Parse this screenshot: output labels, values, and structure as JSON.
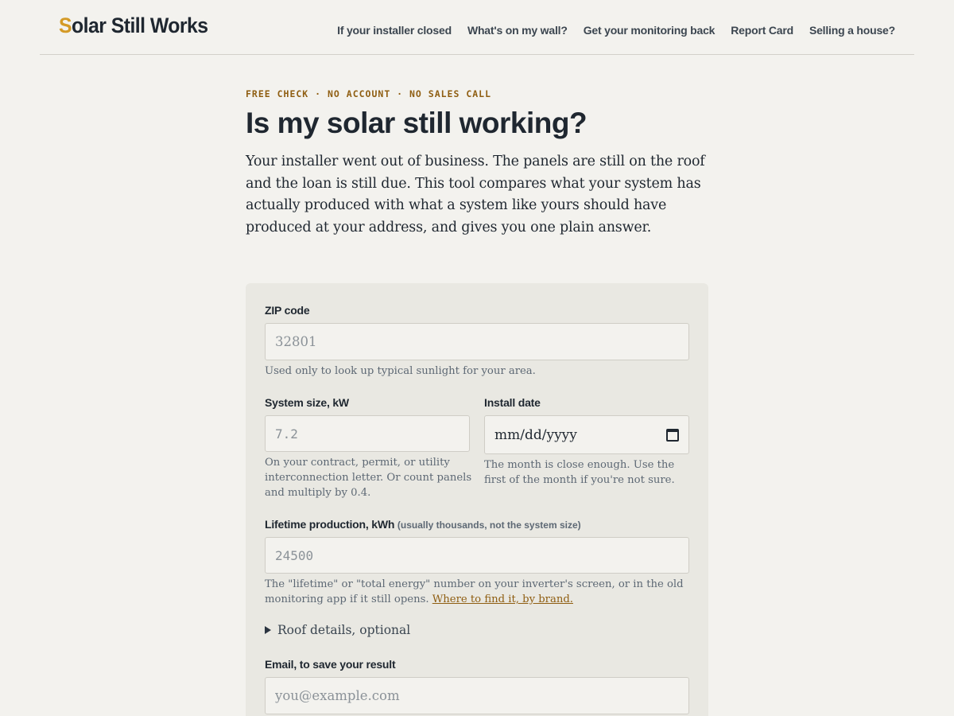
{
  "header": {
    "logo_first": "S",
    "logo_rest": "olar Still Works",
    "nav": [
      "If your installer closed",
      "What's on my wall?",
      "Get your monitoring back",
      "Report Card",
      "Selling a house?"
    ]
  },
  "hero": {
    "eyebrow": "FREE CHECK · NO ACCOUNT · NO SALES CALL",
    "title": "Is my solar still working?",
    "lede": "Your installer went out of business. The panels are still on the roof and the loan is still due. This tool compares what your system has actually produced with what a system like yours should have produced at your address, and gives you one plain answer."
  },
  "form": {
    "zip": {
      "label": "ZIP code",
      "placeholder": "32801",
      "help": "Used only to look up typical sunlight for your area."
    },
    "size": {
      "label": "System size, kW",
      "placeholder": "7.2",
      "help": "On your contract, permit, or utility interconnection letter. Or count panels and multiply by 0.4."
    },
    "install_date": {
      "label": "Install date",
      "value": "mm/dd/yyyy",
      "help": "The month is close enough. Use the first of the month if you're not sure."
    },
    "production": {
      "label": "Lifetime production, kWh",
      "sublabel": "(usually thousands, not the system size)",
      "placeholder": "24500",
      "help": "The \"lifetime\" or \"total energy\" number on your inverter's screen, or in the old monitoring app if it still opens.",
      "help_link": "Where to find it, by brand."
    },
    "roof_details": "Roof details, optional",
    "email": {
      "label": "Email, to save your result",
      "placeholder": "you@example.com"
    }
  },
  "colors": {
    "background": "#f3f2ee",
    "card": "#e9e8e2",
    "accent": "#d49a26",
    "eyebrow": "#8f5e12",
    "text": "#1f2730"
  }
}
